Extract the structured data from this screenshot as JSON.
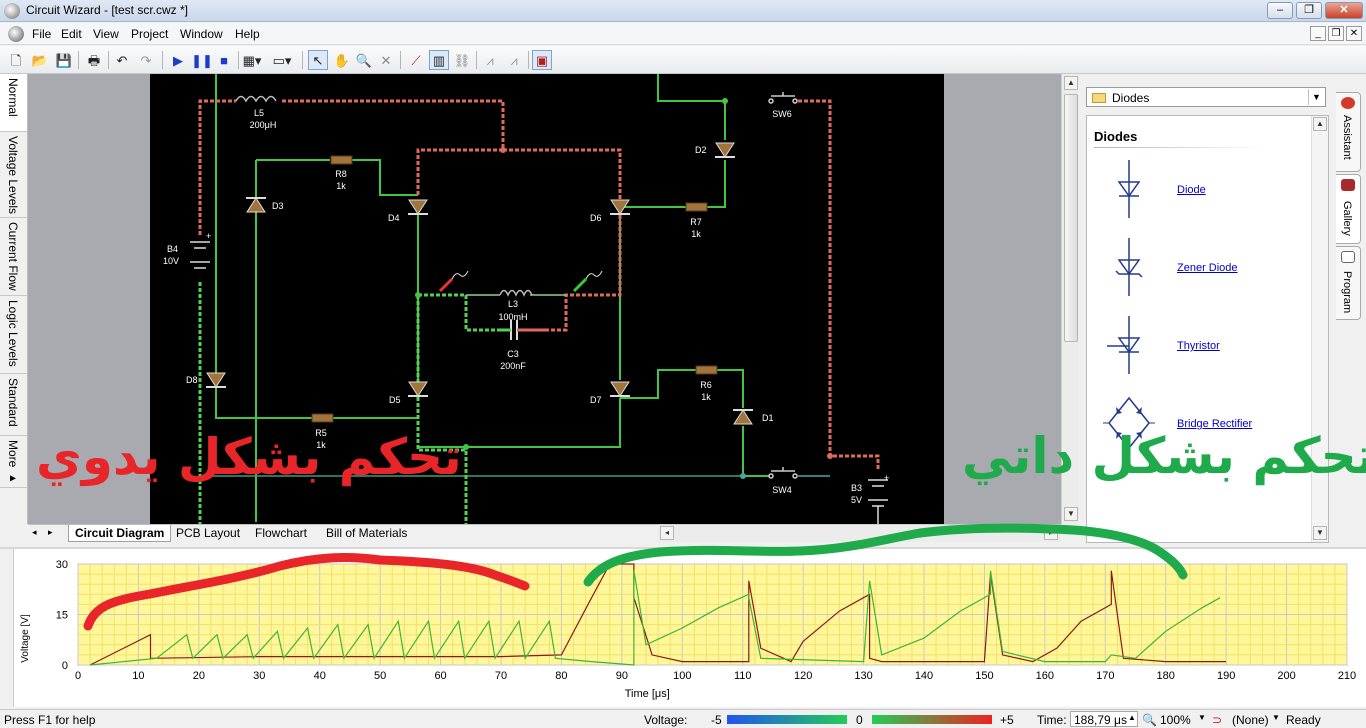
{
  "window": {
    "title": "Circuit Wizard - [test scr.cwz *]",
    "buttons": {
      "minimize": "–",
      "restore": "❐",
      "close": "✕"
    }
  },
  "menu": {
    "items": [
      "File",
      "Edit",
      "View",
      "Project",
      "Window",
      "Help"
    ],
    "mdi_buttons": {
      "minimize": "_",
      "restore": "❐",
      "close": "✕"
    }
  },
  "toolbar": {
    "icons": [
      "new-icon",
      "open-icon",
      "save-icon",
      "print-icon",
      "undo-icon",
      "redo-icon",
      "play-icon",
      "pause-icon",
      "stop-icon",
      "chip-icon",
      "component-icon",
      "select-icon",
      "pan-icon",
      "zoom-icon",
      "delete-icon",
      "probe-icon",
      "graph-icon",
      "network-icon",
      "bridge-icon",
      "bridge2-icon",
      "gallery-icon"
    ]
  },
  "left_tabs": [
    "Normal",
    "Voltage Levels",
    "Current Flow",
    "Logic Levels",
    "Standard",
    "More ▸"
  ],
  "circuit": {
    "components": {
      "L5": {
        "name": "L5",
        "value": "200μH"
      },
      "R8": {
        "name": "R8",
        "value": "1k"
      },
      "D3": {
        "name": "D3"
      },
      "D4": {
        "name": "D4"
      },
      "D6": {
        "name": "D6"
      },
      "D2": {
        "name": "D2"
      },
      "SW6": {
        "name": "SW6"
      },
      "R7": {
        "name": "R7",
        "value": "1k"
      },
      "B4": {
        "name": "B4",
        "value": "10V"
      },
      "L3": {
        "name": "L3",
        "value": "100mH"
      },
      "C3": {
        "name": "C3",
        "value": "200nF"
      },
      "D8": {
        "name": "D8"
      },
      "D5": {
        "name": "D5"
      },
      "D7": {
        "name": "D7"
      },
      "R6": {
        "name": "R6",
        "value": "1k"
      },
      "D1": {
        "name": "D1"
      },
      "R5": {
        "name": "R5",
        "value": "1k"
      },
      "SW4": {
        "name": "SW4"
      },
      "B3": {
        "name": "B3",
        "value": "5V"
      },
      "plus": "+"
    },
    "colors": {
      "background": "#000000",
      "positive": "#e8574b",
      "negative": "#3dbb3d"
    }
  },
  "bottom_tabs": [
    "Circuit Diagram",
    "PCB Layout",
    "Flowchart",
    "Bill of Materials"
  ],
  "gallery": {
    "category": "Diodes",
    "heading": "Diodes",
    "items": [
      "Diode",
      "Zener Diode",
      "Thyristor",
      "Bridge Rectifier"
    ]
  },
  "right_tabs": [
    "Assistant",
    "Gallery",
    "Program"
  ],
  "annotations": {
    "left_text": "تحكم بشكل يدوي",
    "right_text": "تحكم بشكل داتي",
    "left_color": "#e8262a",
    "right_color": "#1faa4b"
  },
  "chart_data": {
    "type": "line",
    "xlabel": "Time [μs]",
    "ylabel": "Voltage [V]",
    "xlim": [
      0,
      210
    ],
    "ylim": [
      0,
      30
    ],
    "x_ticks": [
      0,
      10,
      20,
      30,
      40,
      50,
      60,
      70,
      80,
      90,
      100,
      110,
      120,
      130,
      140,
      150,
      160,
      170,
      180,
      190,
      200,
      210
    ],
    "y_ticks": [
      0,
      15,
      30
    ],
    "grid": true,
    "background": "#fff79a",
    "series": [
      {
        "color": "#8b1a1a",
        "points": [
          [
            2,
            0
          ],
          [
            12,
            9
          ],
          [
            12,
            2
          ],
          [
            30,
            2.5
          ],
          [
            50,
            2.5
          ],
          [
            70,
            2.5
          ],
          [
            80,
            3
          ],
          [
            85,
            20
          ],
          [
            88,
            30
          ],
          [
            92,
            30
          ],
          [
            92,
            20
          ],
          [
            95,
            3
          ],
          [
            100,
            1
          ],
          [
            111,
            1
          ],
          [
            111,
            25
          ],
          [
            113,
            5
          ],
          [
            118,
            1
          ],
          [
            120,
            7
          ],
          [
            126,
            16
          ],
          [
            131,
            21
          ],
          [
            131,
            2
          ],
          [
            133,
            1
          ],
          [
            150,
            1
          ],
          [
            151,
            27
          ],
          [
            153,
            3
          ],
          [
            158,
            1
          ],
          [
            162,
            5
          ],
          [
            166,
            13
          ],
          [
            171,
            18
          ],
          [
            171,
            28
          ],
          [
            173,
            2
          ],
          [
            180,
            1
          ],
          [
            190,
            1
          ]
        ]
      },
      {
        "color": "#3cb43c",
        "points": [
          [
            2,
            0
          ],
          [
            13,
            2
          ],
          [
            18,
            9
          ],
          [
            19,
            2
          ],
          [
            23,
            9
          ],
          [
            24,
            2
          ],
          [
            28,
            9
          ],
          [
            29,
            2
          ],
          [
            33,
            10
          ],
          [
            34,
            2
          ],
          [
            38,
            11
          ],
          [
            39,
            2
          ],
          [
            43,
            12
          ],
          [
            44,
            2
          ],
          [
            48,
            12
          ],
          [
            49,
            2
          ],
          [
            53,
            13
          ],
          [
            54,
            2
          ],
          [
            58,
            13
          ],
          [
            59,
            2
          ],
          [
            63,
            13
          ],
          [
            64,
            2
          ],
          [
            68,
            13
          ],
          [
            69,
            2
          ],
          [
            73,
            13
          ],
          [
            74,
            2
          ],
          [
            78,
            13
          ],
          [
            79,
            2
          ],
          [
            85,
            1
          ],
          [
            92,
            0
          ],
          [
            92,
            28
          ],
          [
            94,
            6
          ],
          [
            100,
            11
          ],
          [
            106,
            17
          ],
          [
            111,
            21
          ],
          [
            111,
            20
          ],
          [
            113,
            2
          ],
          [
            130,
            1
          ],
          [
            131,
            25
          ],
          [
            133,
            3
          ],
          [
            140,
            8
          ],
          [
            146,
            16
          ],
          [
            151,
            21
          ],
          [
            151,
            28
          ],
          [
            153,
            4
          ],
          [
            160,
            1
          ],
          [
            170,
            1
          ],
          [
            171,
            3
          ],
          [
            175,
            2
          ],
          [
            180,
            10
          ],
          [
            186,
            17
          ],
          [
            189,
            20
          ]
        ]
      }
    ]
  },
  "status": {
    "help": "Press F1 for help",
    "voltage_label": "Voltage:",
    "scale_min": "-5",
    "scale_mid": "0",
    "scale_max": "+5",
    "time_label": "Time:",
    "time_value": "188,79 μs",
    "zoom_value": "100%",
    "probe_value": "(None)",
    "state": "Ready"
  }
}
